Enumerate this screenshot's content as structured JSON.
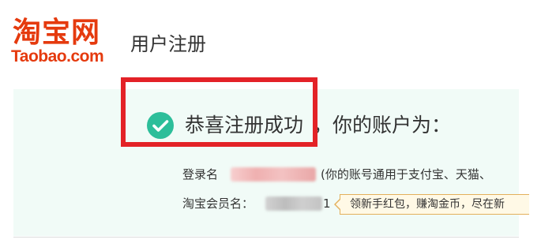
{
  "header": {
    "logo_cn": "淘宝网",
    "logo_en": "Taobao.com",
    "title": "用户注册"
  },
  "success": {
    "icon": "check-circle-icon",
    "message": "恭喜注册成功",
    "account_label": "，你的账户为："
  },
  "details": {
    "login_label": "登录名",
    "login_note": "(你的账号通用于支付宝、天猫、",
    "member_label": "淘宝会员名：",
    "member_suffix": "1"
  },
  "tooltip": {
    "text": "领新手红包，赚淘金币，尽在新"
  },
  "colors": {
    "brand": "#e53a0e",
    "success_green": "#2dbe9a",
    "highlight_red": "#e32227",
    "panel_bg": "#f1fbf7"
  }
}
